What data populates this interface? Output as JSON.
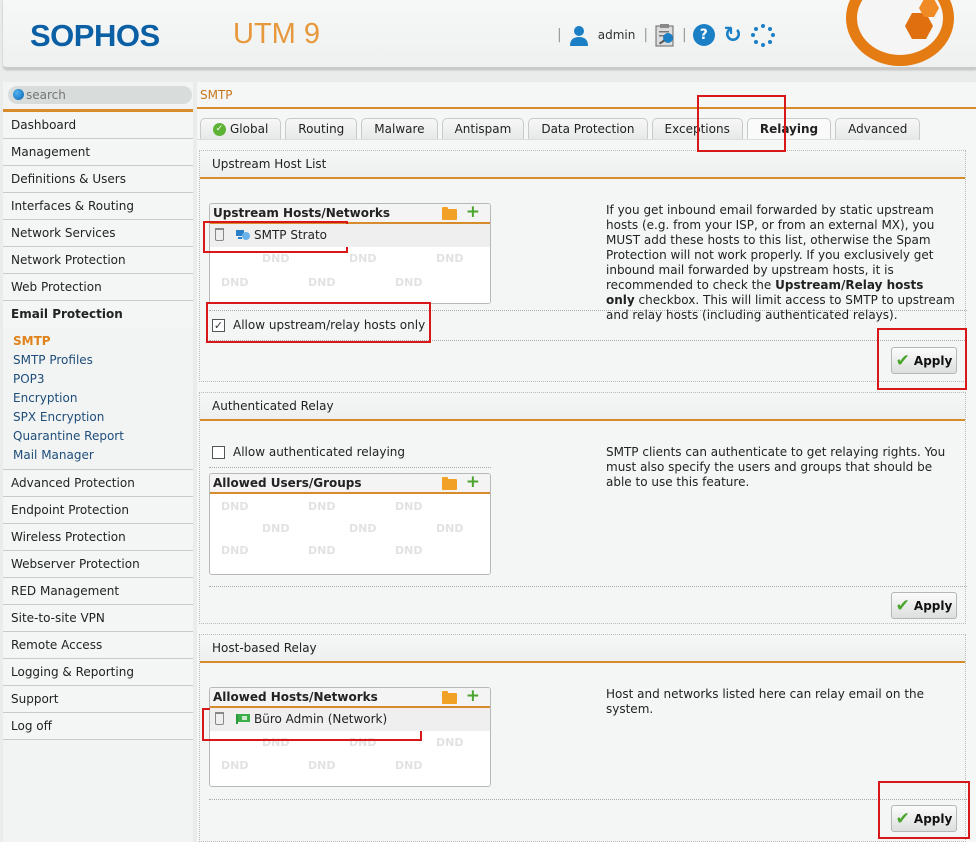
{
  "header": {
    "brand": "SOPHOS",
    "product": "UTM 9",
    "user": "admin",
    "icons": [
      "user-icon",
      "online-help-clipboard-icon",
      "help-icon",
      "reload-icon",
      "activity-spinner-icon",
      "sophos-badge-logo"
    ]
  },
  "sidebar": {
    "search_placeholder": "search",
    "items": [
      {
        "label": "Dashboard"
      },
      {
        "label": "Management"
      },
      {
        "label": "Definitions & Users"
      },
      {
        "label": "Interfaces & Routing"
      },
      {
        "label": "Network Services"
      },
      {
        "label": "Network Protection"
      },
      {
        "label": "Web Protection"
      },
      {
        "label": "Email Protection",
        "expanded": true
      },
      {
        "label": "Advanced Protection"
      },
      {
        "label": "Endpoint Protection"
      },
      {
        "label": "Wireless Protection"
      },
      {
        "label": "Webserver Protection"
      },
      {
        "label": "RED Management"
      },
      {
        "label": "Site-to-site VPN"
      },
      {
        "label": "Remote Access"
      },
      {
        "label": "Logging & Reporting"
      },
      {
        "label": "Support"
      },
      {
        "label": "Log off"
      }
    ],
    "email_sub": [
      "SMTP",
      "SMTP Profiles",
      "POP3",
      "Encryption",
      "SPX Encryption",
      "Quarantine Report",
      "Mail Manager"
    ],
    "active_sub": "SMTP"
  },
  "breadcrumb": "SMTP",
  "tabs": [
    "Global",
    "Routing",
    "Malware",
    "Antispam",
    "Data Protection",
    "Exceptions",
    "Relaying",
    "Advanced"
  ],
  "active_tab": "Relaying",
  "sections": {
    "upstream": {
      "title": "Upstream Host List",
      "box_title": "Upstream Hosts/Networks",
      "entry": "SMTP Strato",
      "checkbox_label": "Allow upstream/relay hosts only",
      "checked": true,
      "desc_pre": "If you get inbound email forwarded by static upstream hosts (e.g. from your ISP, or from an external MX), you MUST add these hosts to this list, otherwise the Spam Protection will not work properly. If you exclusively get inbound mail forwarded by upstream hosts, it is recommended to check the ",
      "desc_bold": "Upstream/Relay hosts only",
      "desc_post": " checkbox. This will limit access to SMTP to upstream and relay hosts (including authenticated relays).",
      "apply": "Apply"
    },
    "auth": {
      "title": "Authenticated Relay",
      "checkbox_label": "Allow authenticated relaying",
      "checked": false,
      "box_title": "Allowed Users/Groups",
      "desc": "SMTP clients can authenticate to get relaying rights. You must also specify the users and groups that should be able to use this feature.",
      "apply": "Apply"
    },
    "host": {
      "title": "Host-based Relay",
      "box_title": "Allowed Hosts/Networks",
      "entry": "Büro Admin (Network)",
      "desc": "Host and networks listed here can relay email on the system.",
      "apply": "Apply"
    }
  },
  "dnd_label": "DND",
  "colors": {
    "accent": "#d88b2a",
    "brand": "#0b5fa5",
    "highlight": "#d81818",
    "ok": "#4aa52c"
  }
}
